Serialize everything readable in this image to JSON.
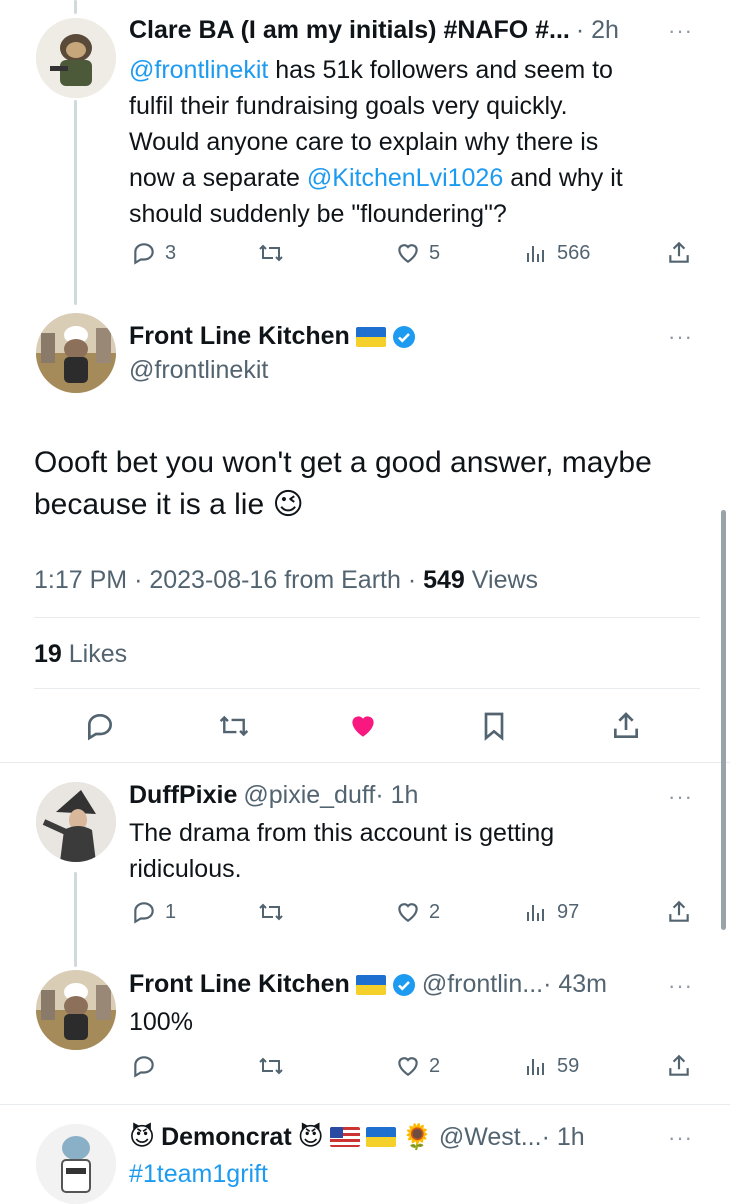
{
  "tweet1": {
    "name": "Clare BA (I am my initials) #NAFO #...",
    "time": "· 2h",
    "body_mention": "@frontlinekit",
    "body_line1_rest": " has 51k followers and seem to",
    "body_line2": "fulfil their fundraising goals very quickly.",
    "body_line3": "Would anyone care to explain why there is",
    "body_line4_pre": "now a separate ",
    "body_line4_mention": "@KitchenLvi1026",
    "body_line4_post": " and why it",
    "body_line5": "should suddenly be \"floundering\"?",
    "replies": "3",
    "likes": "5",
    "views": "566"
  },
  "main_tweet": {
    "name": "Front Line Kitchen",
    "handle": "@frontlinekit",
    "body_line1": "Oooft bet you won't get a good answer, maybe",
    "body_line2": "because it is a lie",
    "emoji": "😉",
    "time": "1:17 PM",
    "date": "2023-08-16",
    "source": "from Earth",
    "views_count": "549",
    "views_label": "Views",
    "likes_count": "19",
    "likes_label": "Likes"
  },
  "reply1": {
    "name": "DuffPixie",
    "handle": "@pixie_duff",
    "time": "· 1h",
    "body_line1": "The drama from this account is getting",
    "body_line2": "ridiculous.",
    "replies": "1",
    "likes": "2",
    "views": "97"
  },
  "reply2": {
    "name": "Front Line Kitchen",
    "handle": "@frontlin...",
    "time": "· 43m",
    "body": "100%",
    "likes": "2",
    "views": "59"
  },
  "reply3": {
    "name": "Demoncrat",
    "handle": "@West...",
    "time": "· 1h",
    "body": "#1team1grift",
    "emoji_devil": "😈",
    "emoji_sunflower": "🌻"
  },
  "colors": {
    "accent": "#1d9bf0",
    "like": "#f91880",
    "muted": "#536471"
  }
}
